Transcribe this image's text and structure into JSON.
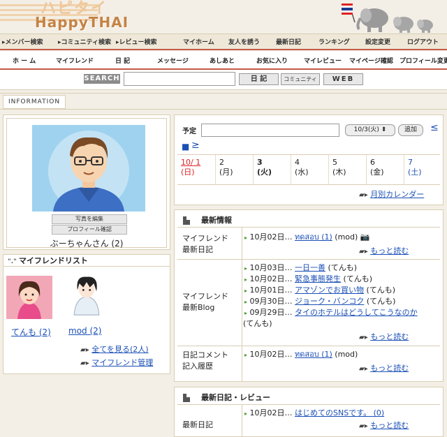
{
  "site": {
    "logo_jp": "ハピタイ",
    "logo_en": "HappyTHAI"
  },
  "nav1": [
    "▸メンバー検索",
    "▸コミュニティ検索",
    "▸レビュー検索",
    "マイホーム",
    "友人を誘う",
    "最新日記",
    "ランキング",
    "設定変更",
    "ログアウト"
  ],
  "nav2": [
    "ホ ー ム",
    "マイフレンド",
    "日 記",
    "メッセージ",
    "あしあと",
    "お気に入り",
    "マイレビュー",
    "マイページ確認",
    "プロフィール変更"
  ],
  "search": {
    "label": "SEARCH",
    "value": "",
    "btn_diary": "日 記",
    "btn_community": "コミュニティ",
    "btn_web": "WEB"
  },
  "info_tab": "INFORMATION",
  "profile": {
    "edit_photo": "写真を編集",
    "check_profile": "プロフィール確認",
    "name": "ぶーちゃんさん (2)"
  },
  "friends": {
    "title": "マイフレンドリスト",
    "items": [
      {
        "name": "てんも (2)"
      },
      {
        "name": "mod (2)"
      }
    ],
    "view_all": "全てを見る(2人)",
    "manage": "マイフレンド管理"
  },
  "schedule": {
    "label": "予定",
    "input": "",
    "date_select": "10/3(火)",
    "add": "追加",
    "prev": "≤",
    "next": "≥",
    "days": [
      {
        "d": "10/ 1",
        "w": "(日)",
        "type": "sun"
      },
      {
        "d": "2",
        "w": "(月)",
        "type": "wd"
      },
      {
        "d": "3",
        "w": "(火)",
        "type": "today"
      },
      {
        "d": "4",
        "w": "(水)",
        "type": "wd"
      },
      {
        "d": "5",
        "w": "(木)",
        "type": "wd"
      },
      {
        "d": "6",
        "w": "(金)",
        "type": "wd"
      },
      {
        "d": "7",
        "w": "(土)",
        "type": "sat"
      }
    ],
    "monthly": "月別カレンダー"
  },
  "news": {
    "title": "最新情報",
    "diary_label_1": "マイフレンド",
    "diary_label_2": "最新日記",
    "diary_entry": {
      "date": "10月02日…",
      "title": "ทดสอบ (1)",
      "who": "(mod)"
    },
    "blog_label_1": "マイフレンド",
    "blog_label_2": "最新Blog",
    "blog_entries": [
      {
        "date": "10月03日…",
        "title": "一日一善",
        "who": "(てんも)"
      },
      {
        "date": "10月02日…",
        "title": "緊急事態発生",
        "who": "(てんも)"
      },
      {
        "date": "10月01日…",
        "title": "アマゾンでお買い物",
        "who": "(てんも)"
      },
      {
        "date": "09月30日…",
        "title": "ジョーク・バンコク",
        "who": "(てんも)"
      },
      {
        "date": "09月29日…",
        "title": "タイのホテルはどうしてこうなのか",
        "who": "(てんも)"
      }
    ],
    "comment_label_1": "日記コメント",
    "comment_label_2": "記入履歴",
    "comment_entry": {
      "date": "10月02日…",
      "title": "ทดสอบ (1)",
      "who": "(mod)"
    },
    "more": "もっと読む"
  },
  "diary": {
    "title": "最新日記・レビュー",
    "label": "最新日記",
    "entry": {
      "date": "10月02日…",
      "title": "はじめてのSNSです。 (0)"
    },
    "more": "もっと読む"
  }
}
